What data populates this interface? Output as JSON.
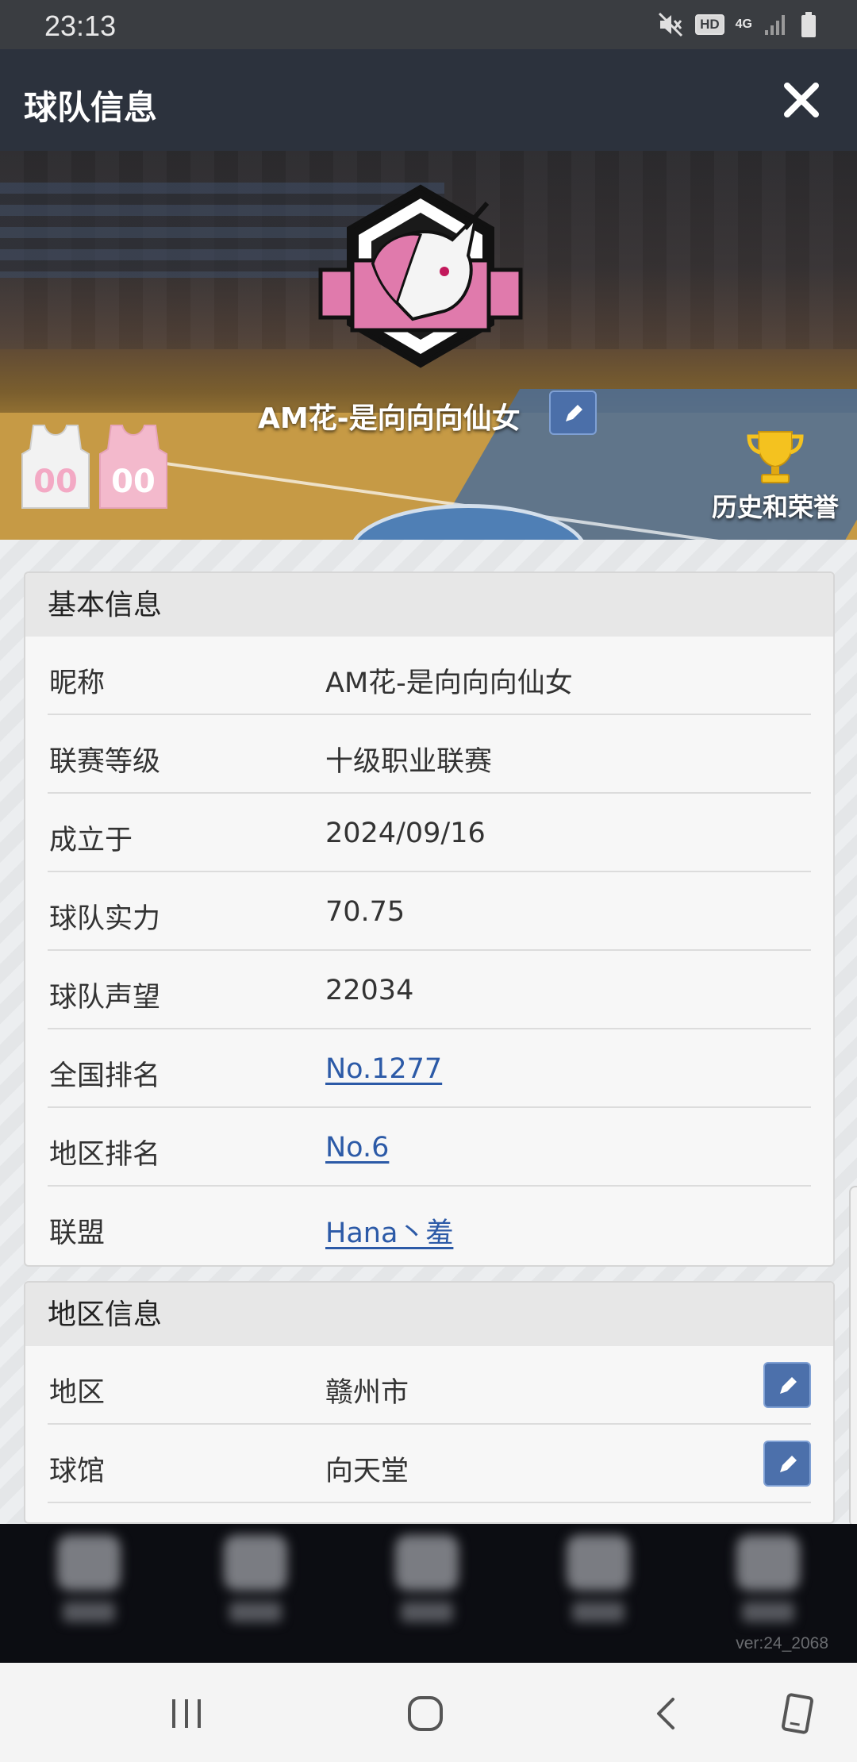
{
  "status_bar": {
    "time": "23:13",
    "hd": "HD",
    "network": "4G"
  },
  "header": {
    "title": "球队信息"
  },
  "hero": {
    "team_name": "AM花-是向向向仙女",
    "home_jersey_number": "00",
    "away_jersey_number": "00",
    "honor_label": "历史和荣誉",
    "colors": {
      "logo_pink": "#e07aac",
      "court": "#c69a45",
      "court_blue": "#4f7fb5"
    }
  },
  "basic_info": {
    "heading": "基本信息",
    "rows": [
      {
        "key": "昵称",
        "value": "AM花-是向向向仙女"
      },
      {
        "key": "联赛等级",
        "value": "十级职业联赛"
      },
      {
        "key": "成立于",
        "value": "2024/09/16"
      },
      {
        "key": "球队实力",
        "value": "70.75"
      },
      {
        "key": "球队声望",
        "value": "22034"
      },
      {
        "key": "全国排名",
        "value": "No.1277"
      },
      {
        "key": "地区排名",
        "value": "No.6"
      },
      {
        "key": "联盟",
        "value": "Hana丶羞"
      }
    ]
  },
  "region_info": {
    "heading": "地区信息",
    "rows": [
      {
        "key": "地区",
        "value": "赣州市"
      },
      {
        "key": "球馆",
        "value": "向天堂"
      }
    ]
  },
  "footer": {
    "version": "ver:24_2068"
  },
  "android_nav": {
    "buttons": [
      "recents-icon",
      "home-icon",
      "back-icon",
      "rotate-icon"
    ]
  },
  "accent_colors": {
    "header_bg": "#2c323d",
    "link": "#2c5aa7",
    "edit_button": "#4c70ab"
  }
}
